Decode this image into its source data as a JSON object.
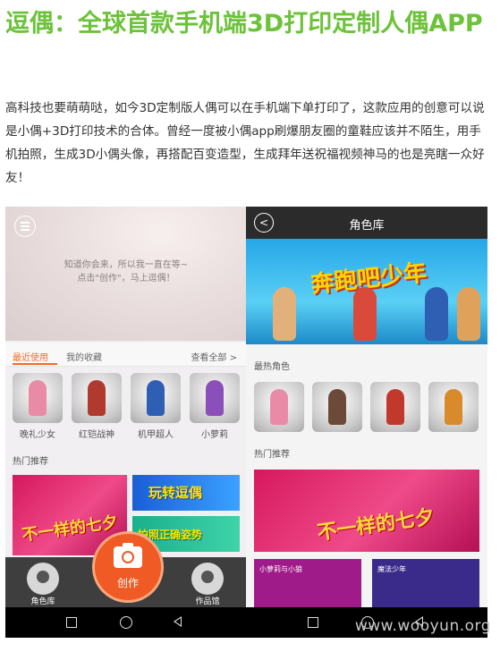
{
  "article": {
    "title": "逗偶：全球首款手机端3D打印定制人偶APP",
    "paragraph": "高科技也要萌萌哒，如今3D定制版人偶可以在手机端下单打印了，这款应用的创意可以说是小偶+3D打印技术的合体。曾经一度被小偶app刷爆朋友圈的童鞋应该并不陌生，用手机拍照，生成3D小偶头像，再搭配百变造型，生成拜年送祝福视频神马的也是亮瞎一众好友！"
  },
  "left_screen": {
    "splash_text_1": "知道你会来，所以我一直在等~",
    "splash_text_2": "点击\"创作\"，马上逗偶！",
    "tabs": {
      "recent": "最近使用",
      "favorites": "我的收藏",
      "view_all": "查看全部 >"
    },
    "characters": [
      {
        "name": "晚礼少女",
        "color": "#e98aa6"
      },
      {
        "name": "红铠战神",
        "color": "#b03a2e"
      },
      {
        "name": "机甲超人",
        "color": "#2f5fb3"
      },
      {
        "name": "小萝莉",
        "color": "#8a4fb8"
      }
    ],
    "hot_section": "热门推荐",
    "banners": {
      "qixi": "不一样的七夕",
      "blue": "玩转逗偶",
      "green": "拍照正确姿势"
    },
    "bottom_nav": {
      "library": "角色库",
      "create": "创作",
      "gallery": "作品馆"
    }
  },
  "right_screen": {
    "header_title": "角色库",
    "banner_title": "奔跑吧少年",
    "hot_characters_label": "最热角色",
    "characters_colors": [
      "#e98aa6",
      "#6b4a3a",
      "#c0392b",
      "#d98a2b"
    ],
    "recommend_label": "热门推荐",
    "big_banner_text": "不一样的七夕",
    "small_banners": [
      {
        "tag": "小萝莉与小狼",
        "color": "#a01b8a"
      },
      {
        "tag": "魔法少年",
        "color": "#3a2a8a"
      }
    ]
  },
  "watermark": "www.wooyun.org",
  "colors": {
    "title_green": "#6cc23a",
    "accent_orange": "#f05a24"
  }
}
